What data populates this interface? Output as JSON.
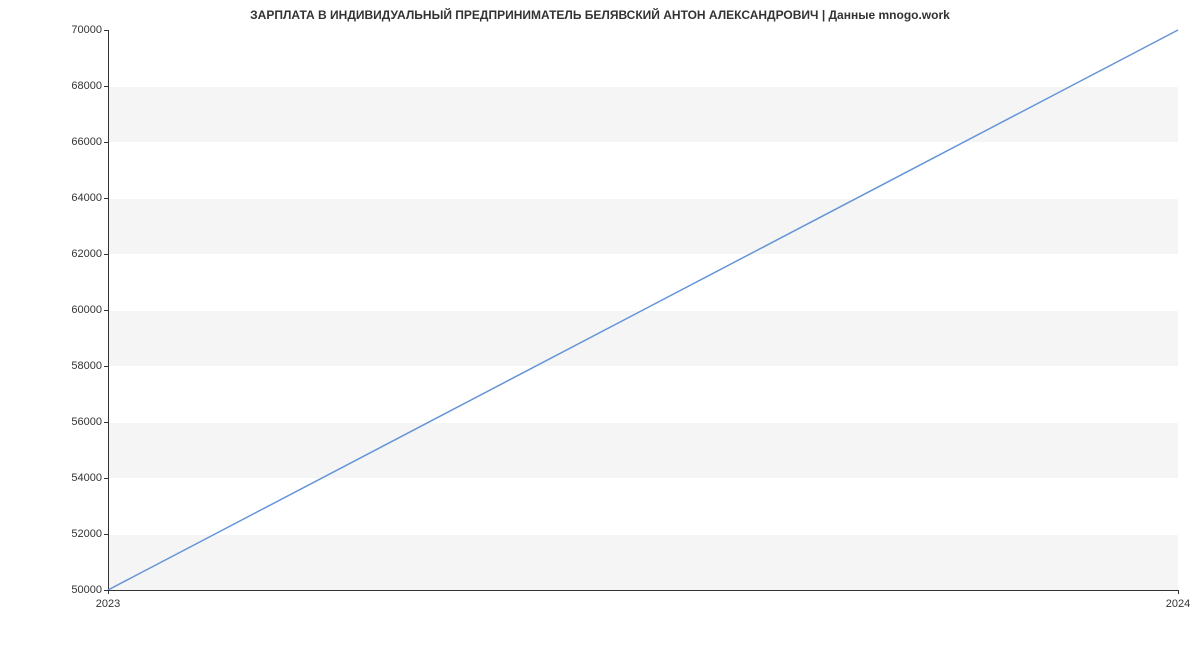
{
  "chart_data": {
    "type": "line",
    "title": "ЗАРПЛАТА В ИНДИВИДУАЛЬНЫЙ ПРЕДПРИНИМАТЕЛЬ БЕЛЯВСКИЙ АНТОН АЛЕКСАНДРОВИЧ | Данные mnogo.work",
    "x": [
      2023,
      2024
    ],
    "values": [
      50000,
      70000
    ],
    "xlabel": "",
    "ylabel": "",
    "xticks": [
      2023,
      2024
    ],
    "yticks": [
      50000,
      52000,
      54000,
      56000,
      58000,
      60000,
      62000,
      64000,
      66000,
      68000,
      70000
    ],
    "xlim": [
      2023,
      2024
    ],
    "ylim": [
      50000,
      70000
    ],
    "line_color": "#6495d8"
  }
}
